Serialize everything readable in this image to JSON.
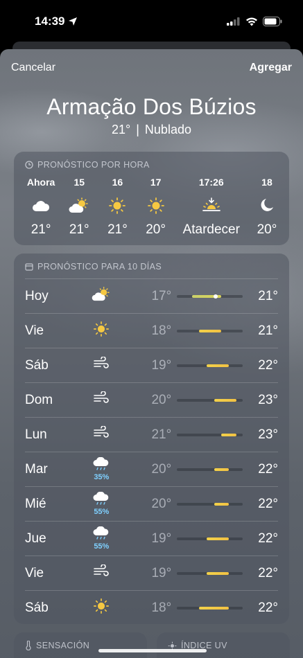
{
  "status_bar": {
    "time": "14:39"
  },
  "nav": {
    "cancel": "Cancelar",
    "add": "Agregar"
  },
  "location": {
    "name": "Armação Dos Búzios",
    "temp": "21°",
    "separator": "|",
    "condition": "Nublado"
  },
  "hourly": {
    "title": "PRONÓSTICO POR HORA",
    "hours": [
      {
        "label": "Ahora",
        "icon": "cloud-icon",
        "temp": "21°"
      },
      {
        "label": "15",
        "icon": "partly-sunny-icon",
        "temp": "21°"
      },
      {
        "label": "16",
        "icon": "sun-icon",
        "temp": "21°"
      },
      {
        "label": "17",
        "icon": "sun-icon",
        "temp": "20°"
      },
      {
        "label": "17:26",
        "icon": "sunset-icon",
        "temp": "Atardecer"
      },
      {
        "label": "18",
        "icon": "moon-icon",
        "temp": "20°"
      }
    ]
  },
  "daily": {
    "title": "PRONÓSTICO PARA 10 DÍAS",
    "days": [
      {
        "day": "Hoy",
        "icon": "partly-sunny-icon",
        "precip": "",
        "low": "17°",
        "high": "21°",
        "range": [
          17,
          21
        ],
        "current": 21
      },
      {
        "day": "Vie",
        "icon": "sun-icon",
        "precip": "",
        "low": "18°",
        "high": "21°",
        "range": [
          18,
          21
        ]
      },
      {
        "day": "Sáb",
        "icon": "wind-icon",
        "precip": "",
        "low": "19°",
        "high": "22°",
        "range": [
          19,
          22
        ]
      },
      {
        "day": "Dom",
        "icon": "wind-icon",
        "precip": "",
        "low": "20°",
        "high": "23°",
        "range": [
          20,
          23
        ]
      },
      {
        "day": "Lun",
        "icon": "wind-icon",
        "precip": "",
        "low": "21°",
        "high": "23°",
        "range": [
          21,
          23
        ]
      },
      {
        "day": "Mar",
        "icon": "rain-icon",
        "precip": "35%",
        "low": "20°",
        "high": "22°",
        "range": [
          20,
          22
        ]
      },
      {
        "day": "Mié",
        "icon": "rain-icon",
        "precip": "55%",
        "low": "20°",
        "high": "22°",
        "range": [
          20,
          22
        ]
      },
      {
        "day": "Jue",
        "icon": "rain-icon",
        "precip": "55%",
        "low": "19°",
        "high": "22°",
        "range": [
          19,
          22
        ]
      },
      {
        "day": "Vie",
        "icon": "wind-icon",
        "precip": "",
        "low": "19°",
        "high": "22°",
        "range": [
          19,
          22
        ]
      },
      {
        "day": "Sáb",
        "icon": "sun-icon",
        "precip": "",
        "low": "18°",
        "high": "22°",
        "range": [
          18,
          22
        ]
      }
    ],
    "scale": [
      15,
      24
    ]
  },
  "bottom_cards": {
    "feels_like": "SENSACIÓN",
    "uv": "ÍNDICE UV"
  },
  "colors": {
    "sun": "#f5c842",
    "bar": "#f3d24a",
    "precip": "#7fd0ff"
  }
}
